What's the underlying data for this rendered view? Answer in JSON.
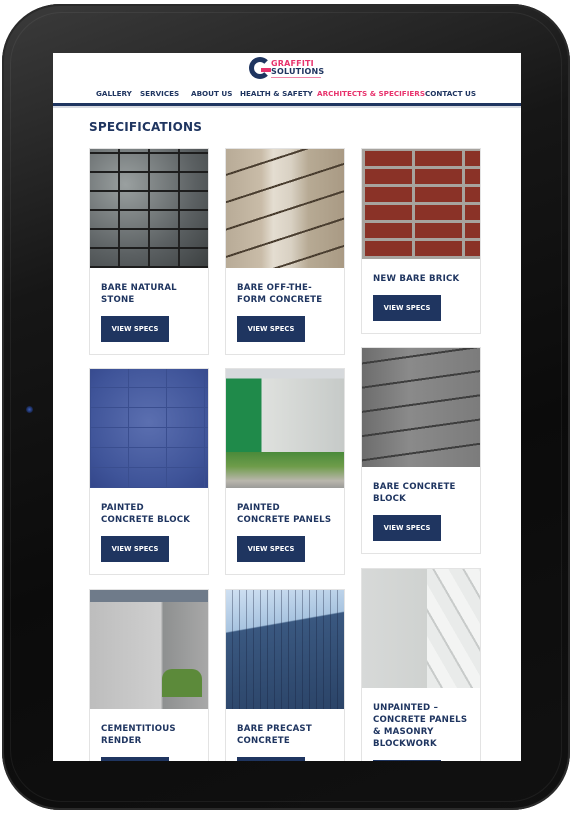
{
  "device": {
    "type": "tablet"
  },
  "header": {
    "logo": {
      "line1": "GRAFFITI",
      "line2": "SOLUTIONS",
      "brand_colors": {
        "primary": "#1f3560",
        "accent": "#e8336d"
      }
    },
    "nav": [
      {
        "label": "GALLERY",
        "active": false
      },
      {
        "label": "SERVICES",
        "active": false
      },
      {
        "label": "ABOUT US",
        "active": false
      },
      {
        "label": "HEALTH & SAFETY",
        "active": false
      },
      {
        "label": "ARCHITECTS & SPECIFIERS",
        "active": true
      },
      {
        "label": "CONTACT US",
        "active": false
      }
    ]
  },
  "page": {
    "title": "SPECIFICATIONS",
    "button_label": "VIEW SPECS",
    "cards": [
      {
        "title": "BARE NATURAL STONE",
        "image": "natural-stone-wall"
      },
      {
        "title": "BARE OFF-THE-FORM CONCRETE",
        "image": "off-form-concrete"
      },
      {
        "title": "NEW BARE BRICK",
        "image": "red-brick-wall"
      },
      {
        "title": "PAINTED CONCRETE BLOCK",
        "image": "painted-blue-block-wall"
      },
      {
        "title": "PAINTED CONCRETE PANELS",
        "image": "green-painted-building"
      },
      {
        "title": "BARE CONCRETE BLOCK",
        "image": "grey-concrete-block"
      },
      {
        "title": "CEMENTITIOUS RENDER",
        "image": "rendered-wall"
      },
      {
        "title": "BARE PRECAST CONCRETE",
        "image": "precast-concrete-building"
      },
      {
        "title": "UNPAINTED – CONCRETE PANELS & MASONRY BLOCKWORK",
        "image": "unpainted-panels-facade"
      }
    ]
  }
}
